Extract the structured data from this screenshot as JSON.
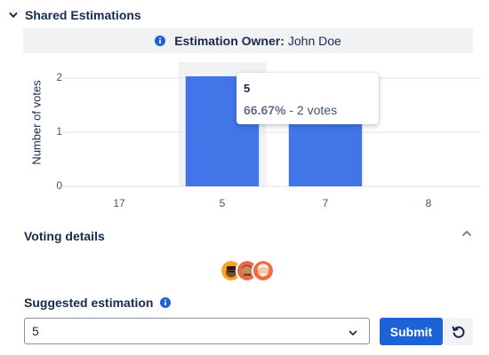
{
  "section": {
    "title": "Shared Estimations"
  },
  "owner": {
    "label": "Estimation Owner:",
    "name": "John Doe"
  },
  "chart_data": {
    "type": "bar",
    "categories": [
      "17",
      "5",
      "7",
      "8"
    ],
    "values": [
      0,
      2,
      2,
      0
    ],
    "ylabel": "Number of votes",
    "xlabel": "",
    "ylim": [
      0,
      2
    ],
    "yticks": [
      "0",
      "1",
      "2"
    ],
    "bar_color": "#4175e8",
    "hover_category": "5",
    "tooltip": {
      "title": "5",
      "percent": "66.67%",
      "detail": " - 2 votes"
    }
  },
  "voting": {
    "title": "Voting details",
    "avatars": [
      "user-avatar-1",
      "user-avatar-2",
      "user-avatar-3"
    ]
  },
  "suggested": {
    "title": "Suggested estimation",
    "value": "5"
  },
  "buttons": {
    "submit": "Submit"
  },
  "colors": {
    "primary": "#1d63d6",
    "info": "#1d63d6"
  }
}
